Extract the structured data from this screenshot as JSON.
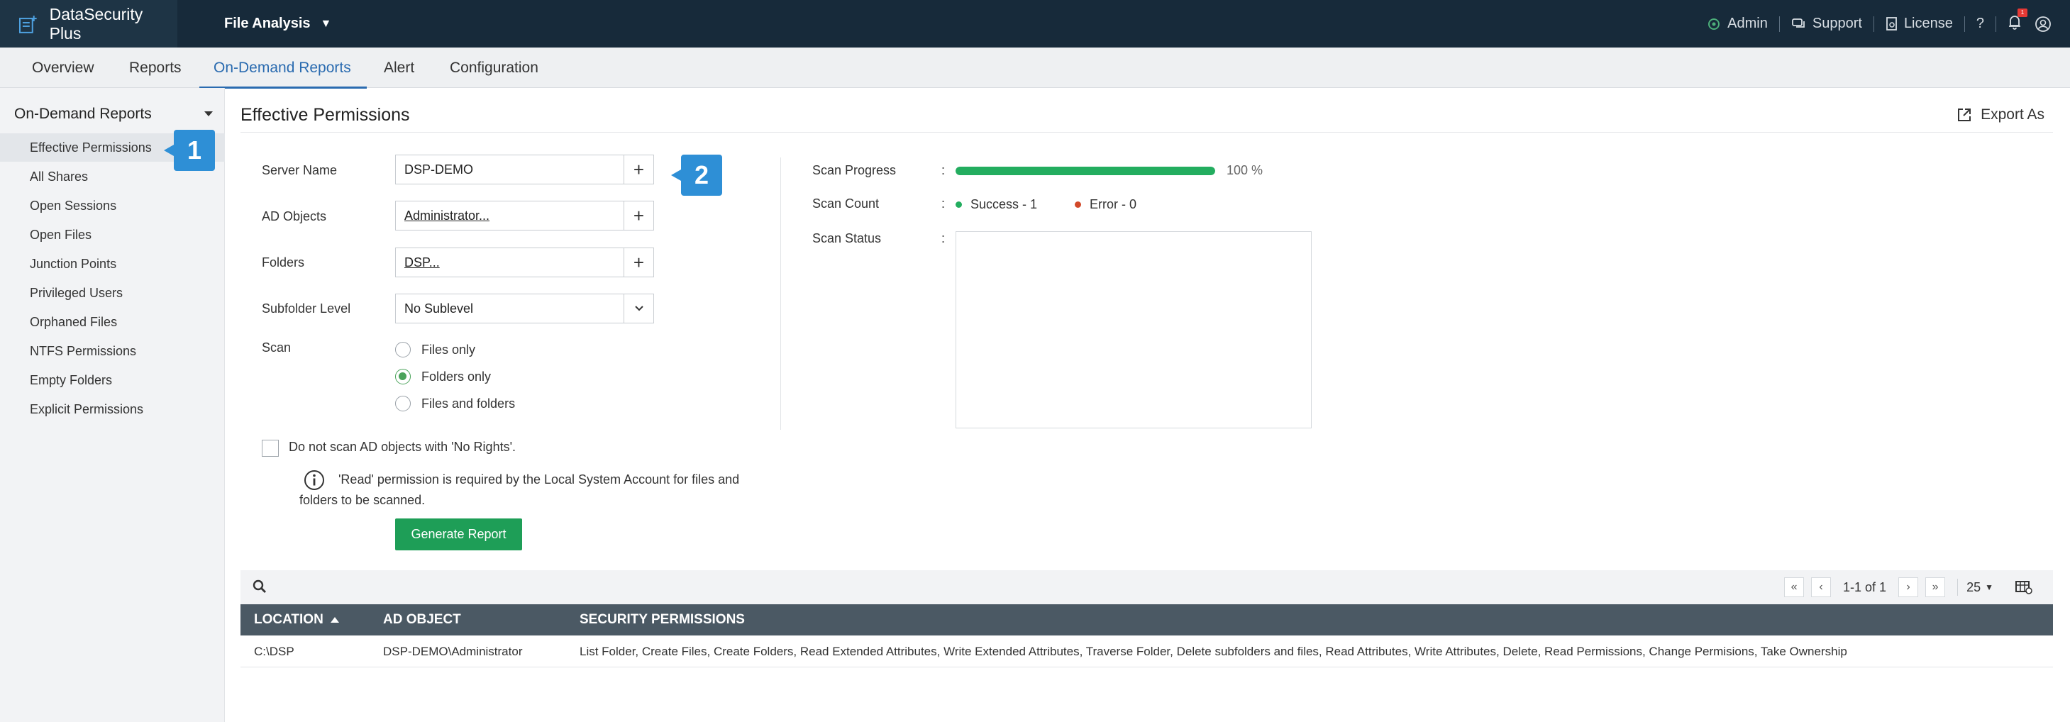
{
  "app": {
    "name": "DataSecurity Plus",
    "module": "File Analysis"
  },
  "topbar": {
    "admin": "Admin",
    "support": "Support",
    "license": "License",
    "help": "?",
    "notification_count": "1"
  },
  "nav": {
    "tabs": [
      "Overview",
      "Reports",
      "On-Demand Reports",
      "Alert",
      "Configuration"
    ],
    "active": "On-Demand Reports"
  },
  "sidebar": {
    "header": "On-Demand Reports",
    "items": [
      "Effective Permissions",
      "All Shares",
      "Open Sessions",
      "Open Files",
      "Junction Points",
      "Privileged Users",
      "Orphaned Files",
      "NTFS Permissions",
      "Empty Folders",
      "Explicit Permissions"
    ],
    "active": "Effective Permissions"
  },
  "callouts": {
    "one": "1",
    "two": "2"
  },
  "page": {
    "title": "Effective Permissions",
    "export_label": "Export As"
  },
  "form": {
    "server_label": "Server Name",
    "server_value": "DSP-DEMO",
    "ad_label": "AD Objects",
    "ad_value": "Administrator...",
    "folders_label": "Folders",
    "folders_value": "DSP...",
    "subfolder_label": "Subfolder Level",
    "subfolder_value": "No Sublevel",
    "scan_label": "Scan",
    "scan_options": [
      "Files only",
      "Folders only",
      "Files and folders"
    ],
    "scan_selected": "Folders only",
    "no_rights_label": "Do not scan AD objects with 'No Rights'.",
    "info_text": "'Read' permission is required by the Local System Account for files and folders to be scanned.",
    "generate_label": "Generate Report"
  },
  "scan": {
    "progress_label": "Scan Progress",
    "progress_value": 100,
    "progress_text": "100 %",
    "count_label": "Scan Count",
    "success_text": "Success - 1",
    "error_text": "Error - 0",
    "status_label": "Scan Status",
    "colon": ":",
    "success_color": "#23ad5f",
    "error_color": "#d2492a"
  },
  "table": {
    "pagination": {
      "info": "1-1 of 1",
      "per_page": "25"
    },
    "columns": [
      "LOCATION",
      "AD OBJECT",
      "SECURITY PERMISSIONS"
    ],
    "rows": [
      {
        "location": "C:\\DSP",
        "ad_object": "DSP-DEMO\\Administrator",
        "permissions": "List Folder, Create Files, Create Folders, Read Extended Attributes, Write Extended Attributes, Traverse Folder, Delete subfolders and files, Read Attributes, Write Attributes, Delete, Read Permissions, Change Permisions, Take Ownership"
      }
    ]
  },
  "colors": {
    "topbar": "#172a3a",
    "accent": "#2a6bb0",
    "button": "#1e9e57",
    "callout": "#2e8fd6",
    "table_header": "#4b5964"
  }
}
